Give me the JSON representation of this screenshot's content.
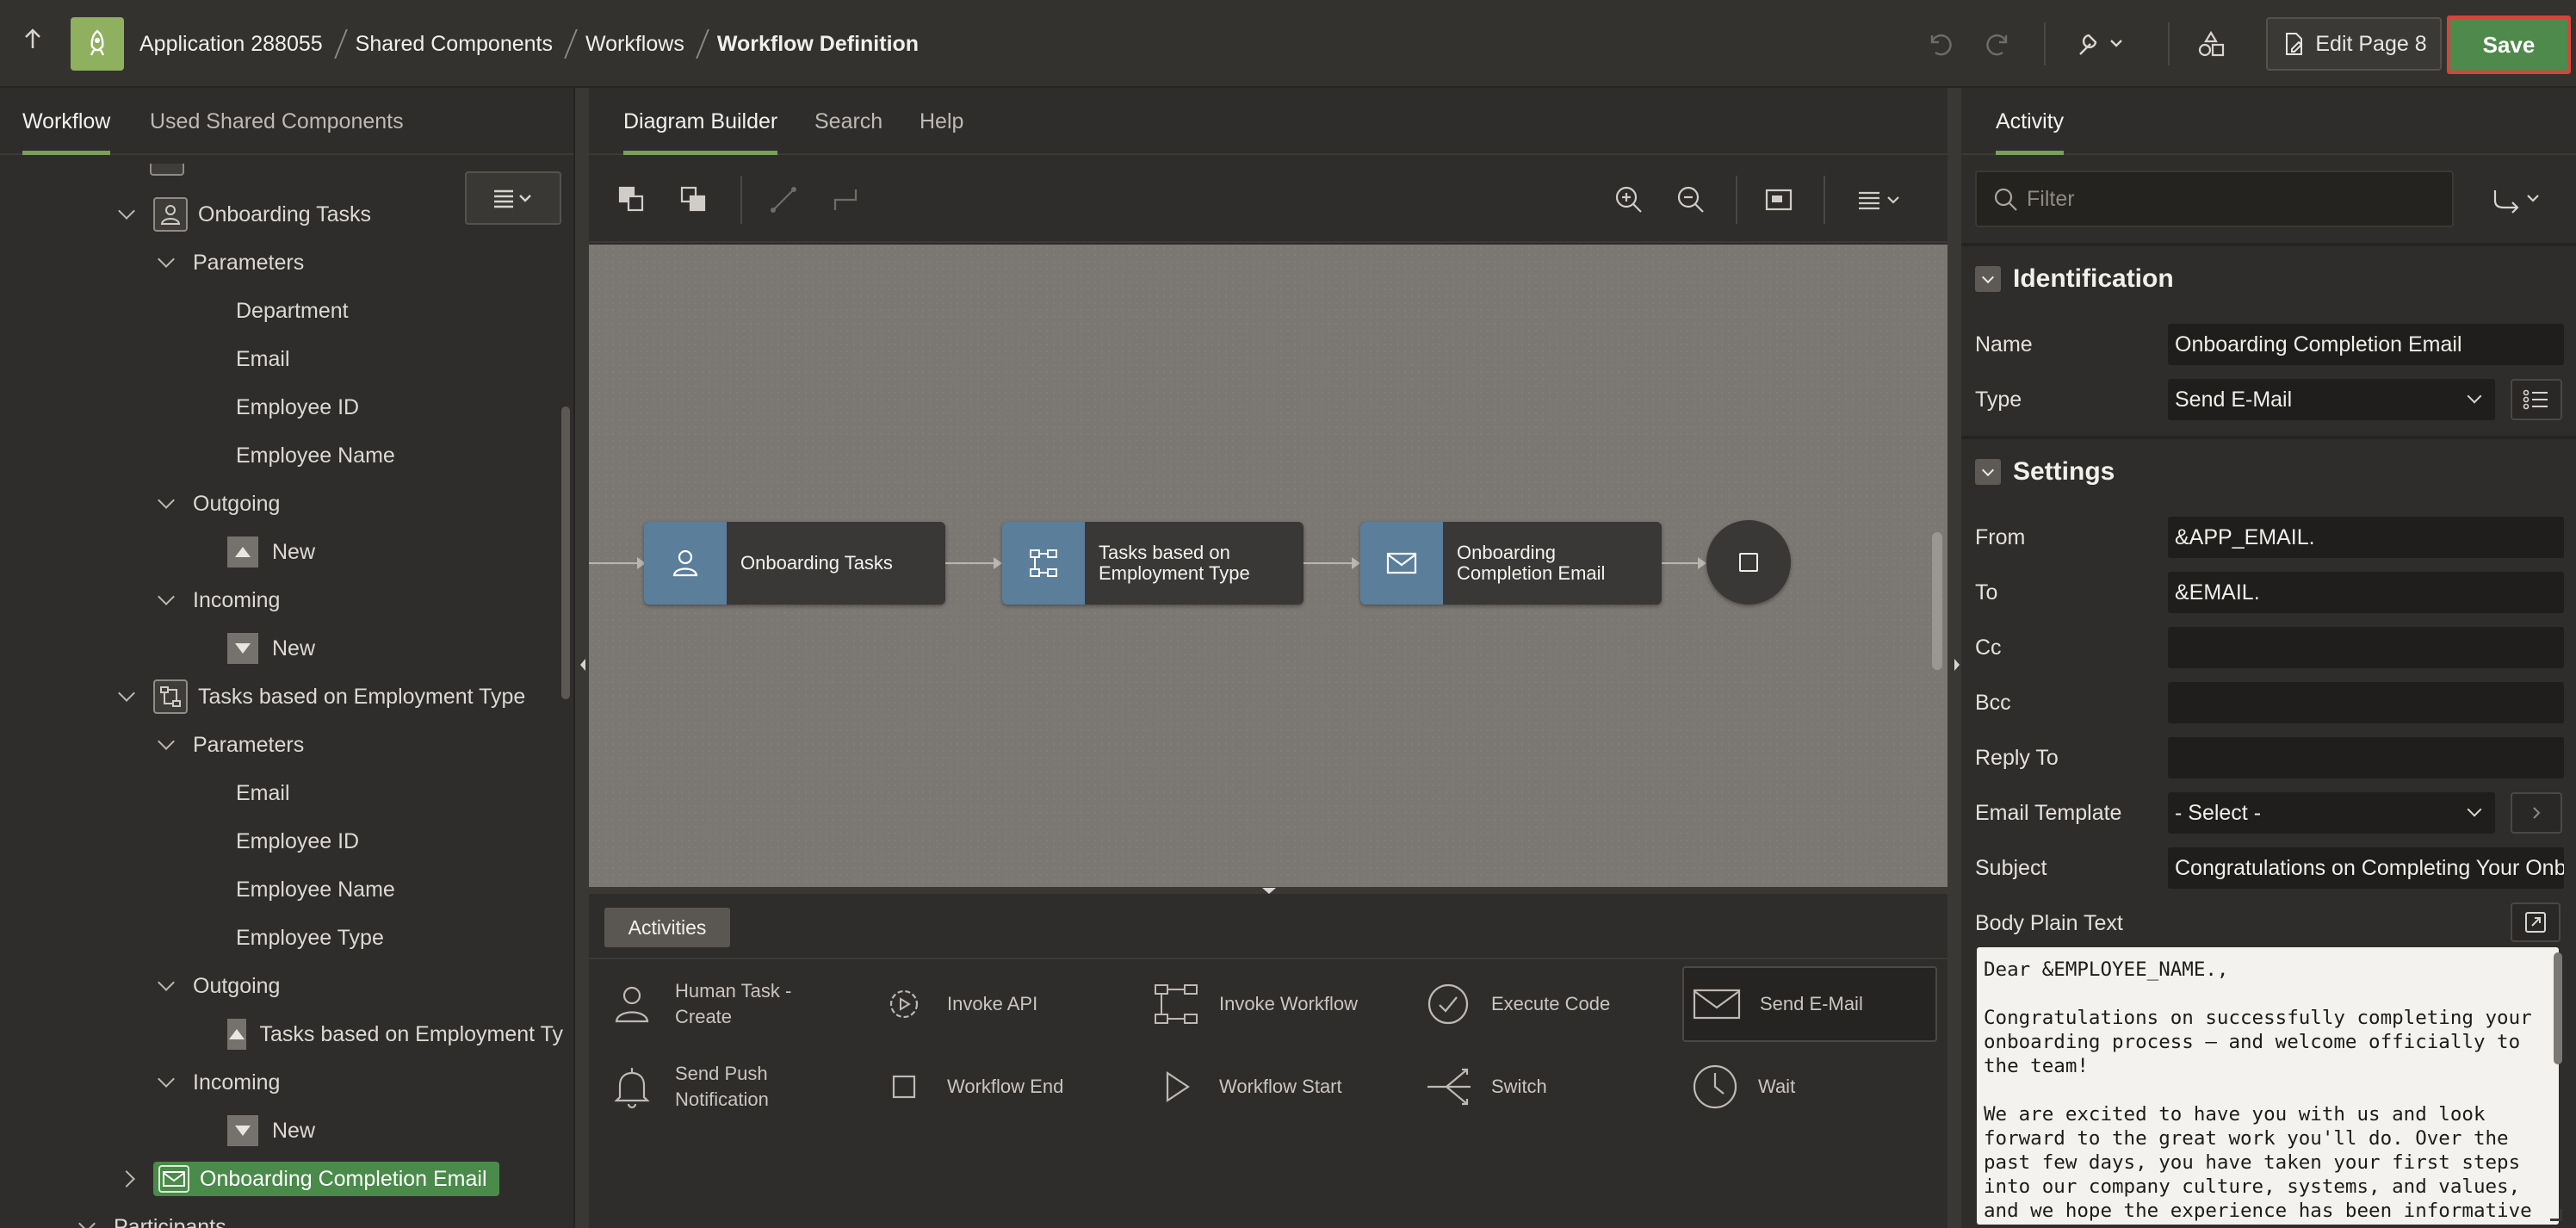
{
  "header": {
    "breadcrumbs": [
      "Application 288055",
      "Shared Components",
      "Workflows",
      "Workflow Definition"
    ],
    "edit_page_label": "Edit Page 8",
    "save_label": "Save"
  },
  "left_panel": {
    "tabs": [
      "Workflow",
      "Used Shared Components"
    ],
    "tree": [
      {
        "label": "Onboarding Tasks",
        "icon": "person-icon"
      },
      {
        "label": "Parameters"
      },
      {
        "label": "Department"
      },
      {
        "label": "Email"
      },
      {
        "label": "Employee ID"
      },
      {
        "label": "Employee Name"
      },
      {
        "label": "Outgoing"
      },
      {
        "label": "New"
      },
      {
        "label": "Incoming"
      },
      {
        "label": "New"
      },
      {
        "label": "Tasks based on Employment Type",
        "icon": "switch-icon"
      },
      {
        "label": "Parameters"
      },
      {
        "label": "Email"
      },
      {
        "label": "Employee ID"
      },
      {
        "label": "Employee Name"
      },
      {
        "label": "Employee Type"
      },
      {
        "label": "Outgoing"
      },
      {
        "label": "Tasks based on Employment Ty"
      },
      {
        "label": "Incoming"
      },
      {
        "label": "New"
      },
      {
        "label": "Onboarding Completion Email",
        "icon": "mail-icon",
        "selected": true
      },
      {
        "label": "Participants"
      }
    ]
  },
  "center": {
    "tabs": [
      "Diagram Builder",
      "Search",
      "Help"
    ],
    "nodes": [
      {
        "label": "Onboarding Tasks",
        "icon": "person-icon"
      },
      {
        "label": "Tasks based on Employment Type",
        "icon": "switch-icon"
      },
      {
        "label": "Onboarding Completion Email",
        "icon": "mail-icon"
      }
    ],
    "palette_tab": "Activities",
    "palette": [
      {
        "label": "Human Task - Create",
        "icon": "person-icon"
      },
      {
        "label": "Invoke API",
        "icon": "gear-icon"
      },
      {
        "label": "Invoke Workflow",
        "icon": "flow-icon"
      },
      {
        "label": "Execute Code",
        "icon": "check-circle-icon"
      },
      {
        "label": "Send E-Mail",
        "icon": "mail-icon"
      },
      {
        "label": "Send Push Notification",
        "icon": "bell-icon"
      },
      {
        "label": "Workflow End",
        "icon": "square-icon"
      },
      {
        "label": "Workflow Start",
        "icon": "play-icon"
      },
      {
        "label": "Switch",
        "icon": "switch-icon"
      },
      {
        "label": "Wait",
        "icon": "clock-icon"
      }
    ]
  },
  "right_panel": {
    "tab": "Activity",
    "filter_placeholder": "Filter",
    "identification": {
      "title": "Identification",
      "name_label": "Name",
      "name_value": "Onboarding Completion Email",
      "type_label": "Type",
      "type_value": "Send E-Mail"
    },
    "settings": {
      "title": "Settings",
      "from_label": "From",
      "from_value": "&APP_EMAIL.",
      "to_label": "To",
      "to_value": "&EMAIL.",
      "cc_label": "Cc",
      "bcc_label": "Bcc",
      "reply_to_label": "Reply To",
      "email_template_label": "Email Template",
      "email_template_value": "- Select -",
      "subject_label": "Subject",
      "subject_value": "Congratulations on Completing Your Onb",
      "body_label": "Body Plain Text",
      "body_value": "Dear &EMPLOYEE_NAME.,\n\nCongratulations on successfully completing your\nonboarding process — and welcome officially to\nthe team!\n\nWe are excited to have you with us and look\nforward to the great work you'll do. Over the\npast few days, you have taken your first steps\ninto our company culture, systems, and values,\nand we hope the experience has been informative"
    }
  },
  "colors": {
    "accent_green": "#4e8a4b",
    "node_side_blue": "#5b7f9a",
    "app_icon_green": "#8fb15f",
    "save_outline_red": "#d9433a"
  }
}
